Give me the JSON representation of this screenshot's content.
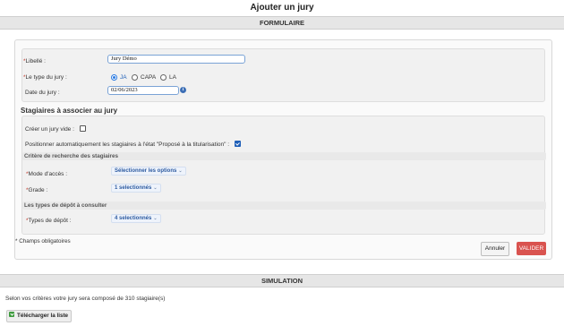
{
  "page": {
    "title": "Ajouter un jury"
  },
  "sections": {
    "formulaire": "FORMULAIRE",
    "simulation": "SIMULATION"
  },
  "form": {
    "libelle_label": "Libellé :",
    "libelle_value": "Jury Démo",
    "type_label": "Le type du jury :",
    "type_options": [
      "JA",
      "CAPA",
      "LA"
    ],
    "type_selected": "JA",
    "date_label": "Date du jury :",
    "date_value": "02/06/2023",
    "info_icon_glyph": "i"
  },
  "stagiaires": {
    "title": "Stagiaires à associer au jury",
    "empty_label": "Créer un jury vide :",
    "empty_checked": false,
    "auto_label": "Positionner automatiquement les stagiaires à l'état \"Proposé à la titularisation\" :",
    "auto_checked": true,
    "criteria_title": "Critère de recherche des stagiaires",
    "mode_label": "Mode d'accès :",
    "mode_value": "Sélectionner les options",
    "grade_label": "Grade :",
    "grade_value": "1 selectionnés",
    "depot_title": "Les types de dépôt à consulter",
    "depot_label": "Types de dépôt :",
    "depot_value": "4 selectionnés",
    "chevron": "⌄"
  },
  "required_star": "*",
  "required_note": "* Champs obligatoires",
  "actions": {
    "cancel": "Annuler",
    "submit": "VALIDER"
  },
  "simulation": {
    "text": "Selon vos critères votre jury sera composé de 310 stagiaire(s)",
    "download": "Télécharger la liste"
  },
  "colors": {
    "accent": "#2a7ae2",
    "submit": "#d9534f",
    "download_icon": "#3c9a3c"
  }
}
